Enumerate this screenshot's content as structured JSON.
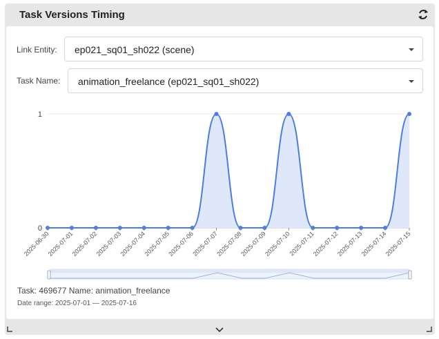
{
  "panel": {
    "title": "Task Versions Timing"
  },
  "form": {
    "link_entity_label": "Link Entity:",
    "link_entity_value": "ep021_sq01_sh022 (scene)",
    "task_name_label": "Task Name:",
    "task_name_value": "animation_freelance (ep021_sq01_sh022)"
  },
  "chart_data": {
    "type": "area",
    "categories": [
      "2025-06-30",
      "2025-07-01",
      "2025-07-02",
      "2025-07-03",
      "2025-07-04",
      "2025-07-05",
      "2025-07-06",
      "2025-07-07",
      "2025-07-08",
      "2025-07-09",
      "2025-07-10",
      "2025-07-11",
      "2025-07-12",
      "2025-07-13",
      "2025-07-14",
      "2025-07-15"
    ],
    "values": [
      0,
      0,
      0,
      0,
      0,
      0,
      0,
      1,
      0,
      0,
      1,
      0,
      0,
      0,
      0,
      1
    ],
    "ylim": [
      0,
      1
    ],
    "yticks": [
      "0",
      "1"
    ],
    "grid": true,
    "colors": {
      "line": "#4a7de2",
      "fill": "#dfe7fb",
      "grid": "#e8e8e8"
    }
  },
  "info": {
    "task_line": "Task: 469677 Name: animation_freelance",
    "date_range": "Date range: 2025-07-01 — 2025-07-16"
  },
  "icons": {
    "refresh": "refresh-icon",
    "expand": "chevron-down-icon",
    "resize": "resize-corner-icon"
  }
}
